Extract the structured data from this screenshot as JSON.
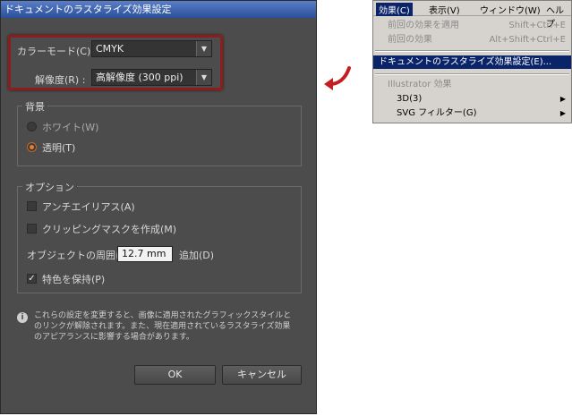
{
  "dialog": {
    "title": "ドキュメントのラスタライズ効果設定",
    "color_mode": {
      "label": "カラーモード(C) :",
      "value": "CMYK"
    },
    "resolution": {
      "label": "解像度(R) :",
      "value": "高解像度 (300 ppi)"
    },
    "background": {
      "legend": "背景",
      "white": "ホワイト(W)",
      "transparent": "透明(T)",
      "selected": "transparent"
    },
    "options": {
      "legend": "オプション",
      "antialias": "アンチエイリアス(A)",
      "antialias_checked": false,
      "clipping_mask": "クリッピングマスクを作成(M)",
      "clipping_mask_checked": false,
      "add_around_label": "オブジェクトの周囲に",
      "add_around_value": "12.7 mm",
      "add_suffix": "追加(D)",
      "preserve_spot": "特色を保持(P)",
      "preserve_spot_checked": true
    },
    "info_lines": [
      "これらの設定を変更すると、画像に適用されたグラフィックスタイルと",
      "のリンクが解除されます。また、現在適用されているラスタライズ効果",
      "のアピアランスに影響する場合があります。"
    ],
    "ok_label": "OK",
    "cancel_label": "キャンセル"
  },
  "menu": {
    "bar": [
      "効果(C)",
      "表示(V)",
      "ウィンドウ(W)",
      "ヘルプ"
    ],
    "items": [
      {
        "label": "前回の効果を適用",
        "shortcut": "Shift+Ctrl+E"
      },
      {
        "label": "前回の効果",
        "shortcut": "Alt+Shift+Ctrl+E"
      },
      {
        "label": "ドキュメントのラスタライズ効果設定(E)..."
      },
      {
        "label": "Illustrator 効果"
      },
      {
        "label": "3D(3)"
      },
      {
        "label": "SVG フィルター(G)"
      }
    ]
  },
  "colors": {
    "dialog_bg": "#4c4c4c",
    "highlight": "#8f1c1c",
    "accent": "#e87d2a",
    "menu_select": "#0a246a"
  }
}
